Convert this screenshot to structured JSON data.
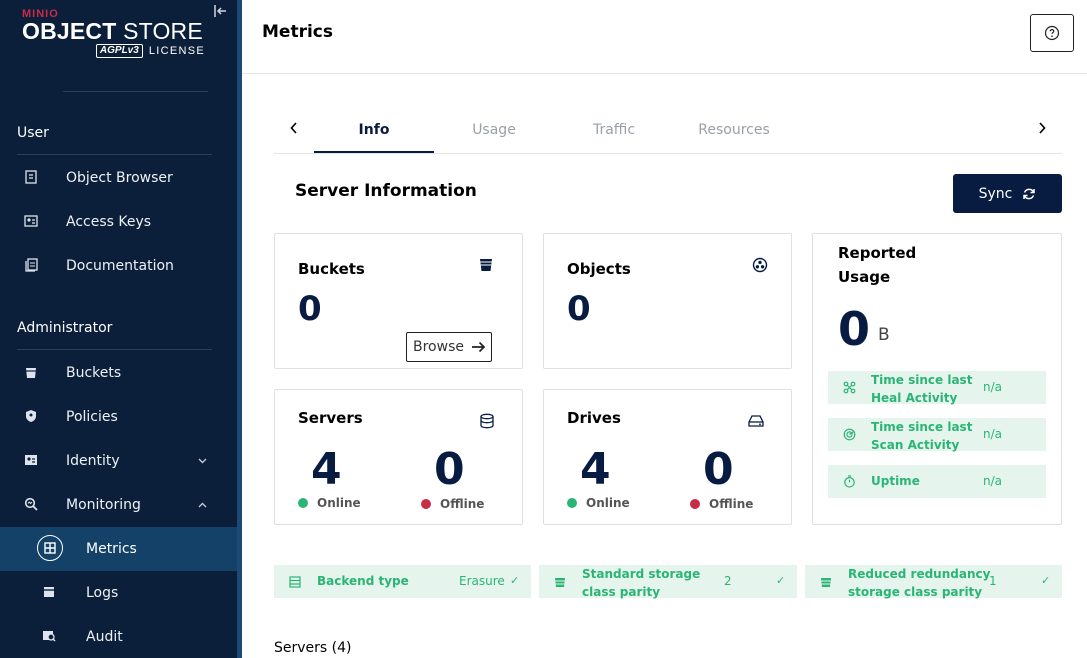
{
  "app": {
    "brand_small": "MINIO",
    "brand_big_bold": "OBJECT",
    "brand_big_rest": " STORE",
    "agpl": "AGPLv3",
    "license": "LICENSE"
  },
  "sidebar": {
    "user_section": "User",
    "user_items": [
      {
        "label": "Object Browser",
        "icon": "object-browser-icon"
      },
      {
        "label": "Access Keys",
        "icon": "access-keys-icon"
      },
      {
        "label": "Documentation",
        "icon": "documentation-icon"
      }
    ],
    "admin_section": "Administrator",
    "admin_items": [
      {
        "label": "Buckets",
        "icon": "buckets-icon"
      },
      {
        "label": "Policies",
        "icon": "policies-icon"
      },
      {
        "label": "Identity",
        "icon": "identity-icon",
        "expanded": false
      },
      {
        "label": "Monitoring",
        "icon": "monitoring-icon",
        "expanded": true
      }
    ],
    "monitoring_items": [
      {
        "label": "Metrics",
        "icon": "metrics-icon",
        "active": true
      },
      {
        "label": "Logs",
        "icon": "logs-icon"
      },
      {
        "label": "Audit",
        "icon": "audit-icon"
      }
    ]
  },
  "header": {
    "title": "Metrics"
  },
  "tabs": [
    "Info",
    "Usage",
    "Traffic",
    "Resources"
  ],
  "active_tab": "Info",
  "server_info": {
    "title": "Server Information",
    "sync_label": "Sync"
  },
  "cards": {
    "buckets": {
      "label": "Buckets",
      "value": "0",
      "browse_label": "Browse"
    },
    "objects": {
      "label": "Objects",
      "value": "0"
    },
    "servers": {
      "label": "Servers",
      "online": "4",
      "offline": "0",
      "online_label": "Online",
      "offline_label": "Offline"
    },
    "drives": {
      "label": "Drives",
      "online": "4",
      "offline": "0",
      "online_label": "Online",
      "offline_label": "Offline"
    },
    "usage": {
      "label_line1": "Reported",
      "label_line2": "Usage",
      "value": "0",
      "unit": "B",
      "heal_label_1": "Time since last",
      "heal_label_2": "Heal Activity",
      "heal_value": "n/a",
      "scan_label_1": "Time since last",
      "scan_label_2": "Scan Activity",
      "scan_value": "n/a",
      "uptime_label": "Uptime",
      "uptime_value": "n/a"
    }
  },
  "parity": {
    "backend_label": "Backend type",
    "backend_value": "Erasure",
    "standard_label_1": "Standard storage",
    "standard_label_2": "class parity",
    "standard_value": "2",
    "reduced_label_1": "Reduced redundancy",
    "reduced_label_2": "storage class parity",
    "reduced_value": "1"
  },
  "servers_heading": "Servers (4)",
  "colors": {
    "sidebar_bg": "#0b1f3a",
    "active_bg": "#134167",
    "accent_navy": "#081c42",
    "online_green": "#2bb575",
    "offline_red": "#c72c48",
    "badge_bg": "#e5f4ec"
  }
}
